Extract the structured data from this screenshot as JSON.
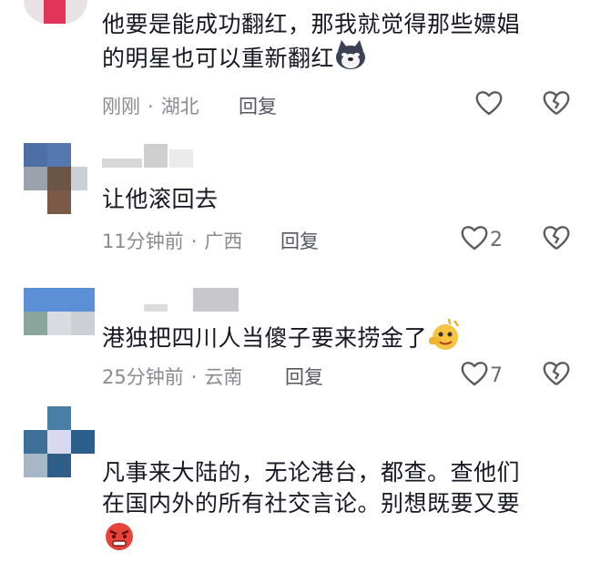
{
  "comments": [
    {
      "text_lines": [
        "他要是能成功翻红，那我就觉得那些嫖娼",
        "的明星也可以重新翻红"
      ],
      "emoji": "husky-emoji",
      "time": "刚刚",
      "location": "湖北",
      "reply_label": "回复",
      "likes": ""
    },
    {
      "text_lines": [
        "让他滚回去"
      ],
      "time": "11分钟前",
      "location": "广西",
      "reply_label": "回复",
      "likes": "2"
    },
    {
      "text_lines": [
        "港独把四川人当傻子要来捞金了"
      ],
      "emoji": "pointing-face-emoji",
      "time": "25分钟前",
      "location": "云南",
      "reply_label": "回复",
      "likes": "7"
    },
    {
      "text_lines": [
        "凡事来大陆的，无论港台，都查。查他们",
        "在国内外的所有社交言论。别想既要又要"
      ],
      "emoji": "angry-face-emoji",
      "time": "",
      "location": "",
      "reply_label": "",
      "likes": ""
    }
  ],
  "meta_separator": "·",
  "icons": {
    "like": "heart-icon",
    "dislike": "broken-heart-icon"
  },
  "colors": {
    "text": "#161823",
    "meta": "#8a8b91",
    "icon": "#5a5b61"
  }
}
